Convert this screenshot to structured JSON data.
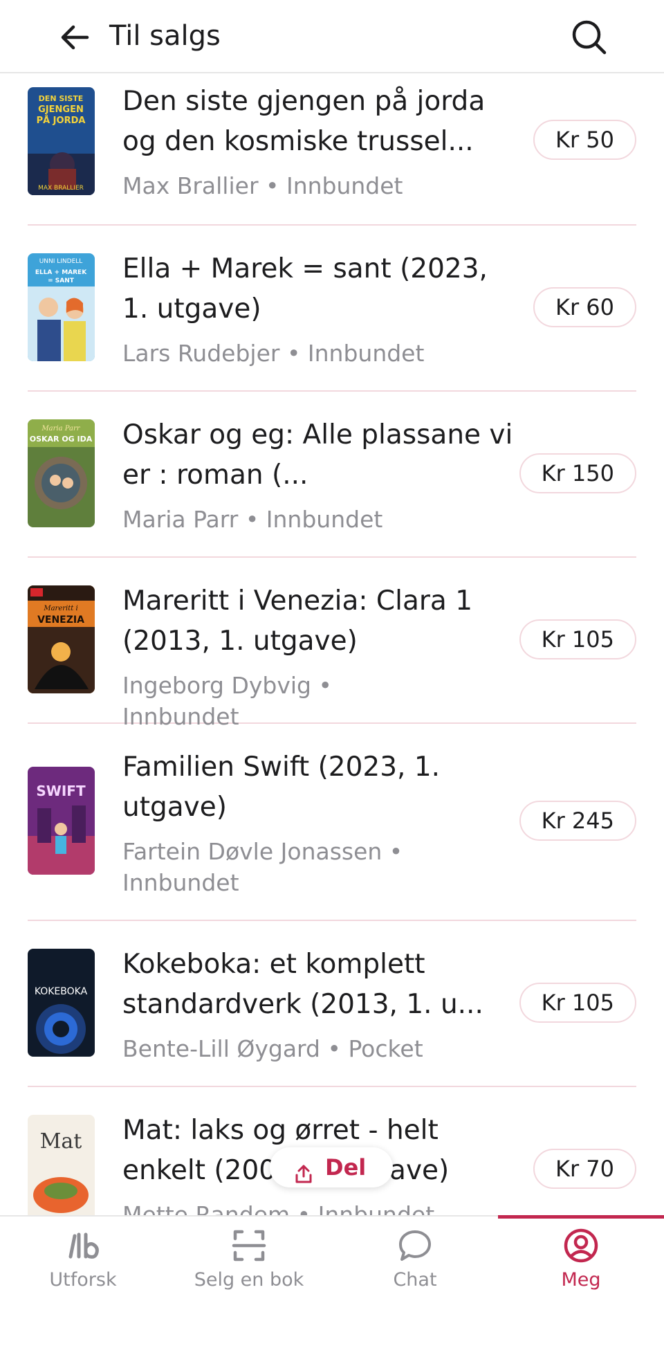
{
  "header": {
    "title": "Til salgs",
    "back_icon": "arrow-left-icon",
    "search_icon": "search-icon"
  },
  "books": [
    {
      "title": "Den siste gjengen på jorda og den kosmiske trussel...",
      "subtitle": "Max Brallier • Innbundet",
      "price": "Kr 50"
    },
    {
      "title": "Ella + Marek = sant (2023, 1. utgave)",
      "subtitle": "Lars Rudebjer • Innbundet",
      "price": "Kr 60"
    },
    {
      "title": "Oskar og eg: Alle plassane vi er : roman (...",
      "subtitle": "Maria Parr • Innbundet",
      "price": "Kr 150"
    },
    {
      "title": "Mareritt i Venezia: Clara 1 (2013, 1. utgave)",
      "subtitle": "Ingeborg Dybvig • Innbundet",
      "price": "Kr 105"
    },
    {
      "title": "Familien Swift (2023, 1. utgave)",
      "subtitle": "Fartein Døvle Jonassen • Innbundet",
      "price": "Kr 245"
    },
    {
      "title": "Kokeboka: et komplett standardverk (2013, 1. u...",
      "subtitle": "Bente-Lill Øygard • Pocket",
      "price": "Kr 105"
    },
    {
      "title": "Mat: laks og ørret - helt enkelt (2009, 1. utgave)",
      "subtitle": "Mette Randem • Innbundet",
      "price": "Kr 70"
    }
  ],
  "cover_texts": {
    "b1": "DEN SISTE GJENGEN PÅ JORDA",
    "b2_author": "UNNI LINDELL",
    "b2_title": "ELLA + MAREK = SANT",
    "b3": "Maria Parr OSKAR OG IDA",
    "b4": "Mareritt i VENEZIA",
    "b5": "SWIFT",
    "b6": "KOKEBOKA",
    "b7": "Mat"
  },
  "share_button": {
    "label": "Del",
    "icon": "share-icon"
  },
  "tabs": [
    {
      "label": "Utforsk",
      "icon": "library-icon",
      "active": false
    },
    {
      "label": "Selg en bok",
      "icon": "scan-icon",
      "active": false
    },
    {
      "label": "Chat",
      "icon": "chat-bubble-icon",
      "active": false
    },
    {
      "label": "Meg",
      "icon": "profile-icon",
      "active": true
    }
  ],
  "colors": {
    "accent": "#c2274f",
    "divider": "#f2d7dd",
    "muted_text": "#8e8e93"
  }
}
